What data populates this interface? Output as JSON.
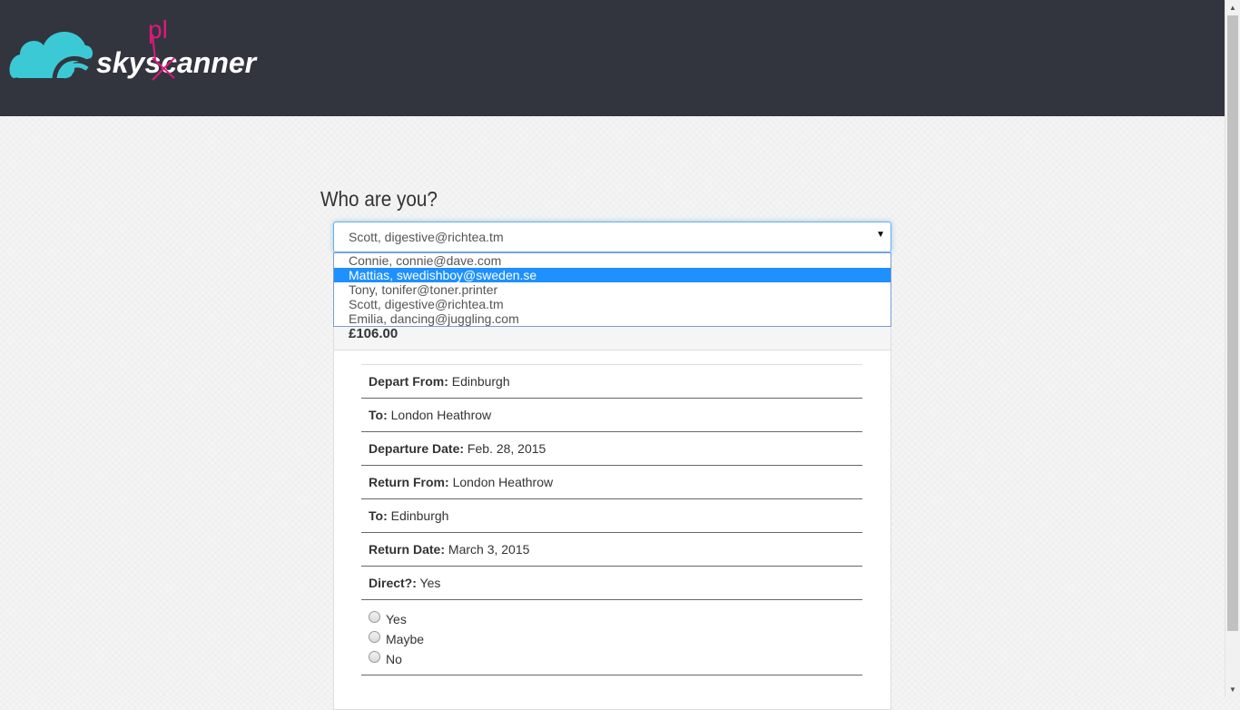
{
  "brand": {
    "name": "skyscanner",
    "annotation": "pl",
    "colors": {
      "cloud": "#3cc9d6",
      "header": "#32353e",
      "scribble": "#e0187c"
    }
  },
  "form": {
    "heading": "Who are you?",
    "select": {
      "value": "Scott, digestive@richtea.tm",
      "options": [
        "Connie, connie@dave.com",
        "Mattias, swedishboy@sweden.se",
        "Tony, tonifer@toner.printer",
        "Scott, digestive@richtea.tm",
        "Emilia, dancing@juggling.com"
      ],
      "highlighted_index": 1
    }
  },
  "flight": {
    "price": "£106.00",
    "rows": [
      {
        "label": "Depart From:",
        "value": "Edinburgh"
      },
      {
        "label": "To:",
        "value": "London Heathrow"
      },
      {
        "label": "Departure Date:",
        "value": "Feb. 28, 2015"
      },
      {
        "label": "Return From:",
        "value": "London Heathrow"
      },
      {
        "label": "To:",
        "value": "Edinburgh"
      },
      {
        "label": "Return Date:",
        "value": "March 3, 2015"
      },
      {
        "label": "Direct?:",
        "value": "Yes"
      }
    ],
    "choices": [
      "Yes",
      "Maybe",
      "No"
    ]
  }
}
